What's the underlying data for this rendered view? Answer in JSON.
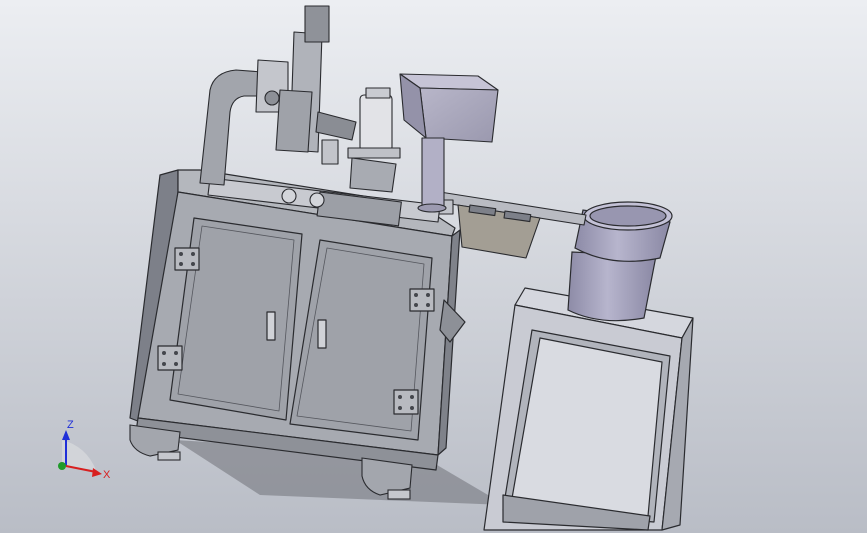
{
  "triad": {
    "z_label": "Z",
    "x_label": "X",
    "z_color": "#1f2fd8",
    "x_color": "#d81f1f",
    "y_color": "#1f9a2a"
  },
  "colors": {
    "background_top": "#eceef2",
    "background_bottom": "#b9bdc6",
    "cabinet": "#a7aab1",
    "cabinet_dark": "#7d8089",
    "panel": "#9fa2a9",
    "outline": "#2a2b2f",
    "bowl": "#a6a4bf",
    "bowl_dark": "#8a88a4",
    "stand": "#c9cbd3"
  }
}
